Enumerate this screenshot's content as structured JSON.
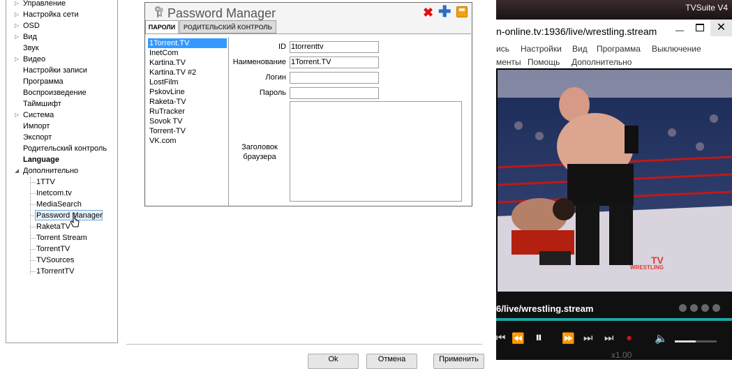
{
  "tree": {
    "top_items": [
      {
        "label": "Управление",
        "arrow": "▷"
      },
      {
        "label": "Настройка сети",
        "arrow": "▷"
      },
      {
        "label": "OSD",
        "arrow": "▷"
      },
      {
        "label": "Вид",
        "arrow": "▷"
      },
      {
        "label": "Звук",
        "arrow": ""
      },
      {
        "label": "Видео",
        "arrow": "▷"
      },
      {
        "label": "Настройки записи",
        "arrow": ""
      },
      {
        "label": "Программа",
        "arrow": ""
      },
      {
        "label": "Воспроизведение",
        "arrow": ""
      },
      {
        "label": "Таймшифт",
        "arrow": ""
      },
      {
        "label": "Система",
        "arrow": "▷"
      },
      {
        "label": "Импорт",
        "arrow": ""
      },
      {
        "label": "Экспорт",
        "arrow": ""
      },
      {
        "label": "Родительский контроль",
        "arrow": ""
      },
      {
        "label": "Language",
        "arrow": ""
      },
      {
        "label": "Дополнительно",
        "arrow": "◢"
      }
    ],
    "children": [
      "1TTV",
      "Inetcom.tv",
      "MediaSearch",
      "Password Manager",
      "RaketaTV",
      "Torrent Stream",
      "TorrentTV",
      "TVSources",
      "1TorrentTV"
    ],
    "selected_child": "Password Manager"
  },
  "password_manager": {
    "title": "Password Manager",
    "close_glyph": "✖",
    "add_glyph": "✚",
    "tabs": [
      "ПАРОЛИ",
      "РОДИТЕЛЬСКИЙ КОНТРОЛЬ"
    ],
    "list": [
      "1Torrent.TV",
      "InetCom",
      "Kartina.TV",
      "Kartina.TV #2",
      "LostFilm",
      "PskovLine",
      "Raketa-TV",
      "RuTracker",
      "Sovok TV",
      "Torrent-TV",
      "VK.com"
    ],
    "selected_item": "1Torrent.TV",
    "fields": {
      "id_label": "ID",
      "id_value": "1torrenttv",
      "name_label": "Наименование",
      "name_value": "1Torrent.TV",
      "login_label": "Логин",
      "login_value": "",
      "password_label": "Пароль",
      "password_value": "",
      "header_label_line1": "Заголовок",
      "header_label_line2": "браузера"
    }
  },
  "bottom_buttons": [
    "Ok",
    "Отмена",
    "Применить"
  ],
  "player": {
    "brand": "TVSuite V4",
    "url": "n-online.tv:1936/live/wrestling.stream",
    "min_glyph": "—",
    "close_glyph": "✕",
    "menu_row1": [
      "ись",
      "Настройки",
      "Вид",
      "Программа",
      "Выключение"
    ],
    "menu_row2": [
      "менты",
      "Помощь",
      "Дополнительно"
    ],
    "video_logo_line1": "TV",
    "video_logo_line2": "WRESTLING",
    "stream_label": "6/live/wrestling.stream",
    "controls": [
      "⏮",
      "⏪",
      "⏸",
      "⏩",
      "⏭",
      "⏭",
      "●",
      "🔈"
    ],
    "speed": "x1.00",
    "accent_color": "#1fa7a3"
  }
}
